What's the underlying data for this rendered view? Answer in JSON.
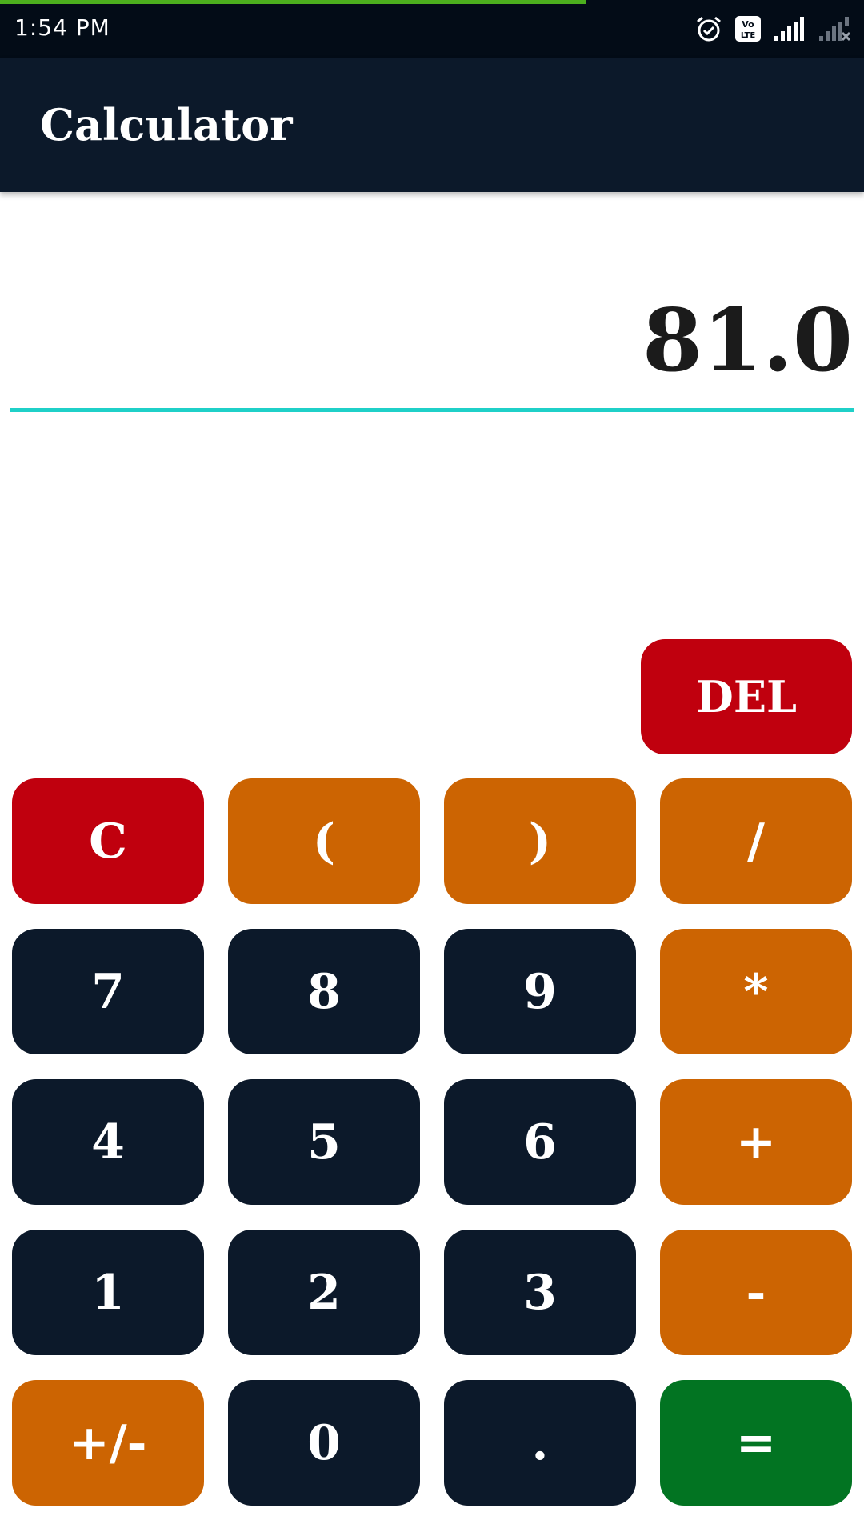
{
  "status_bar": {
    "time": "1:54 PM",
    "icons": [
      "alarm-icon",
      "volte-icon",
      "signal-icon",
      "signal-no-service-icon"
    ],
    "volte_label": "Vo LTE"
  },
  "app_bar": {
    "title": "Calculator"
  },
  "display": {
    "value": "81.0"
  },
  "keys": {
    "del": "DEL",
    "clear": "C",
    "open_paren": "(",
    "close_paren": ")",
    "divide": "/",
    "seven": "7",
    "eight": "8",
    "nine": "9",
    "multiply": "*",
    "four": "4",
    "five": "5",
    "six": "6",
    "plus": "+",
    "one": "1",
    "two": "2",
    "three": "3",
    "minus": "-",
    "plus_minus": "+/-",
    "zero": "0",
    "decimal": ".",
    "equals": "="
  },
  "colors": {
    "dark": "#0c192a",
    "orange": "#cc6402",
    "red": "#c0000e",
    "green": "#027422",
    "accent_line": "#1fd0c8"
  }
}
